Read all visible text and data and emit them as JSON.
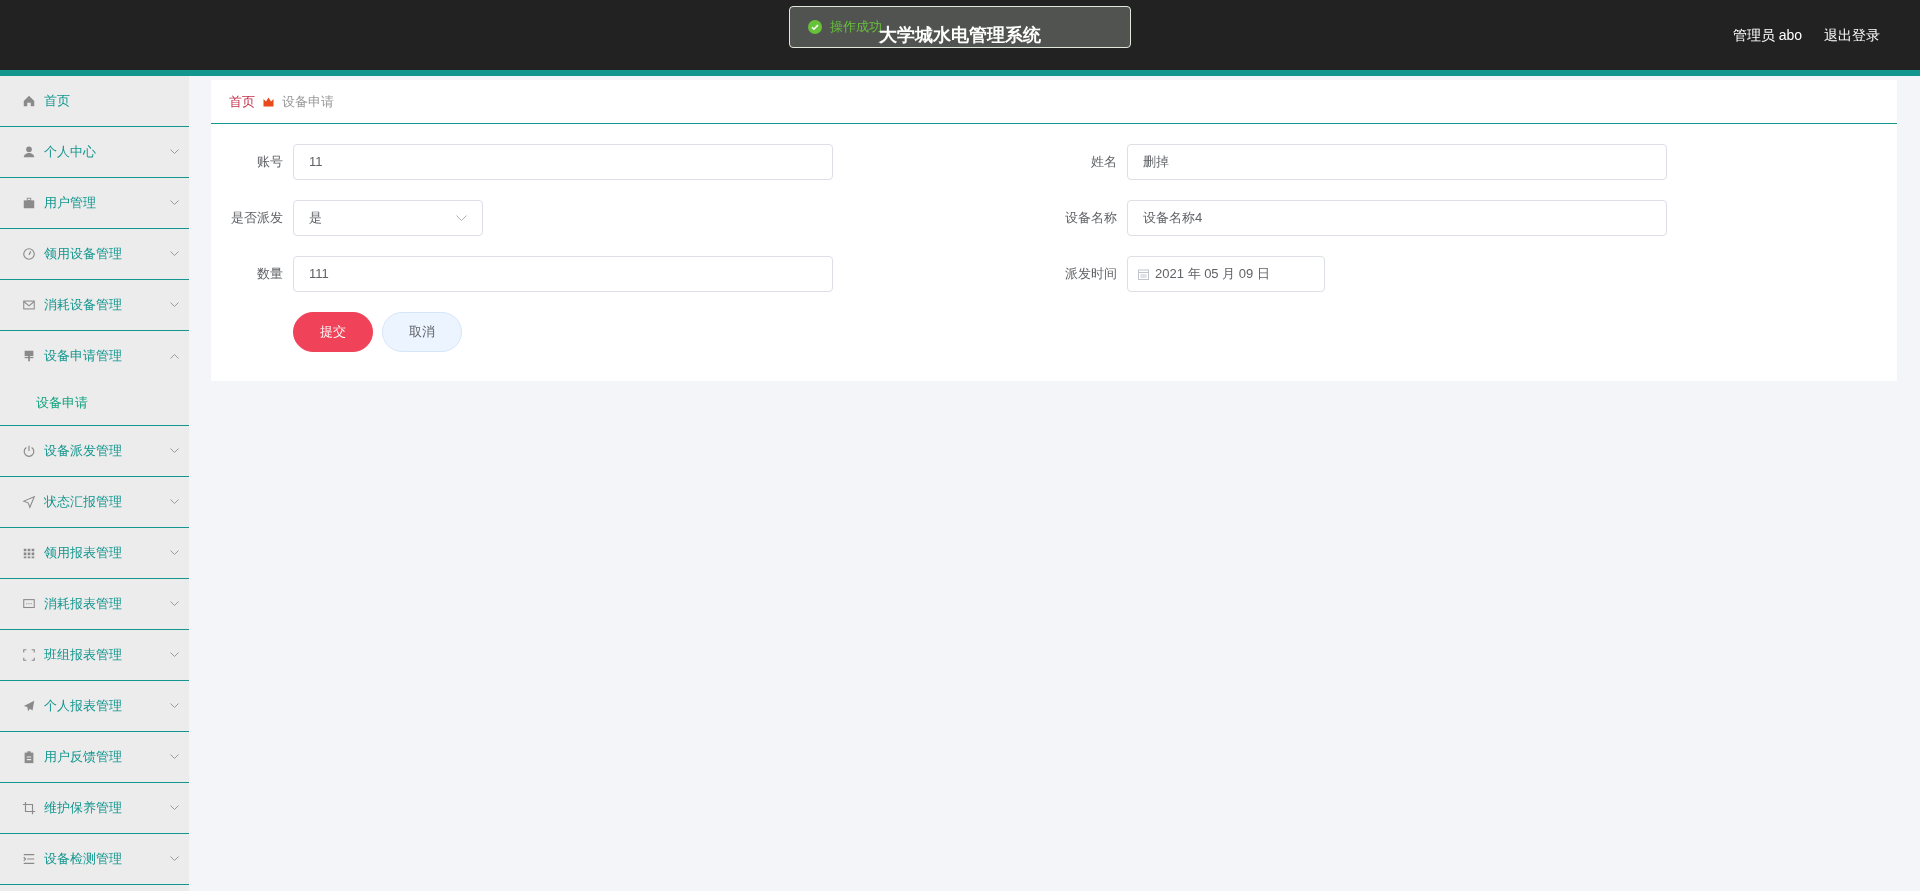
{
  "header": {
    "title": "大学城水电管理系统",
    "user": "管理员 abo",
    "logout": "退出登录"
  },
  "toast": {
    "kind": "success",
    "message": "操作成功"
  },
  "sidebar": {
    "items": [
      {
        "label": "首页"
      },
      {
        "label": "个人中心",
        "expanded": false
      },
      {
        "label": "用户管理",
        "expanded": false
      },
      {
        "label": "领用设备管理",
        "expanded": false
      },
      {
        "label": "消耗设备管理",
        "expanded": false
      },
      {
        "label": "设备申请管理",
        "expanded": true,
        "children": [
          {
            "label": "设备申请",
            "selected": true
          }
        ]
      },
      {
        "label": "设备派发管理",
        "expanded": false
      },
      {
        "label": "状态汇报管理",
        "expanded": false
      },
      {
        "label": "领用报表管理",
        "expanded": false
      },
      {
        "label": "消耗报表管理",
        "expanded": false
      },
      {
        "label": "班组报表管理",
        "expanded": false
      },
      {
        "label": "个人报表管理",
        "expanded": false
      },
      {
        "label": "用户反馈管理",
        "expanded": false
      },
      {
        "label": "维护保养管理",
        "expanded": false
      },
      {
        "label": "设备检测管理",
        "expanded": false
      }
    ]
  },
  "breadcrumb": [
    {
      "label": "首页",
      "selected": false
    },
    {
      "label": "设备申请",
      "selected": true
    }
  ],
  "form": {
    "fields": [
      {
        "label": "账号",
        "kind": "text",
        "value": "11"
      },
      {
        "label": "姓名",
        "kind": "text",
        "value": "删掉"
      },
      {
        "label": "是否派发",
        "kind": "select",
        "value": "是"
      },
      {
        "label": "设备名称",
        "kind": "text",
        "value": "设备名称4"
      },
      {
        "label": "数量",
        "kind": "text",
        "value": "111"
      },
      {
        "label": "派发时间",
        "kind": "date",
        "value": "2021 年 05 月 09 日"
      }
    ],
    "buttons": [
      {
        "label": "提交",
        "kind": "primary"
      },
      {
        "label": "取消",
        "kind": "secondary"
      }
    ]
  }
}
